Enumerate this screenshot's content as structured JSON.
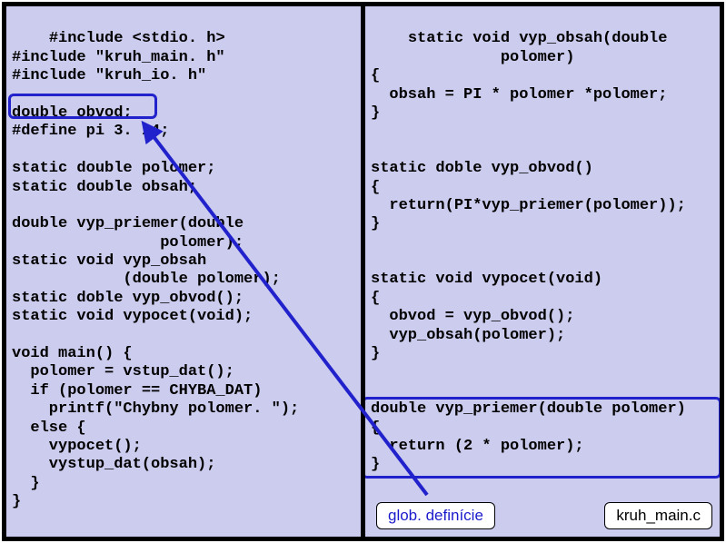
{
  "left_code": "#include <stdio. h>\n#include \"kruh_main. h\"\n#include \"kruh_io. h\"\n\ndouble obvod;\n#define pi 3. 14;\n\nstatic double polomer;\nstatic double obsah;\n\ndouble vyp_priemer(double\n                polomer);\nstatic void vyp_obsah\n            (double polomer);\nstatic doble vyp_obvod();\nstatic void vypocet(void);\n\nvoid main() {\n  polomer = vstup_dat();\n  if (polomer == CHYBA_DAT)\n    printf(\"Chybny polomer. \");\n  else {\n    vypocet();\n    vystup_dat(obsah);\n  }\n}",
  "right_code": "static void vyp_obsah(double\n              polomer)\n{\n  obsah = PI * polomer *polomer;\n}\n\n\nstatic doble vyp_obvod()\n{\n  return(PI*vyp_priemer(polomer));\n}\n\n\nstatic void vypocet(void)\n{\n  obvod = vyp_obvod();\n  vyp_obsah(polomer);\n}\n\n\ndouble vyp_priemer(double polomer)\n{\n  return (2 * polomer);\n}",
  "labels": {
    "glob_def": "glob. definície",
    "filename": "kruh_main.c"
  }
}
